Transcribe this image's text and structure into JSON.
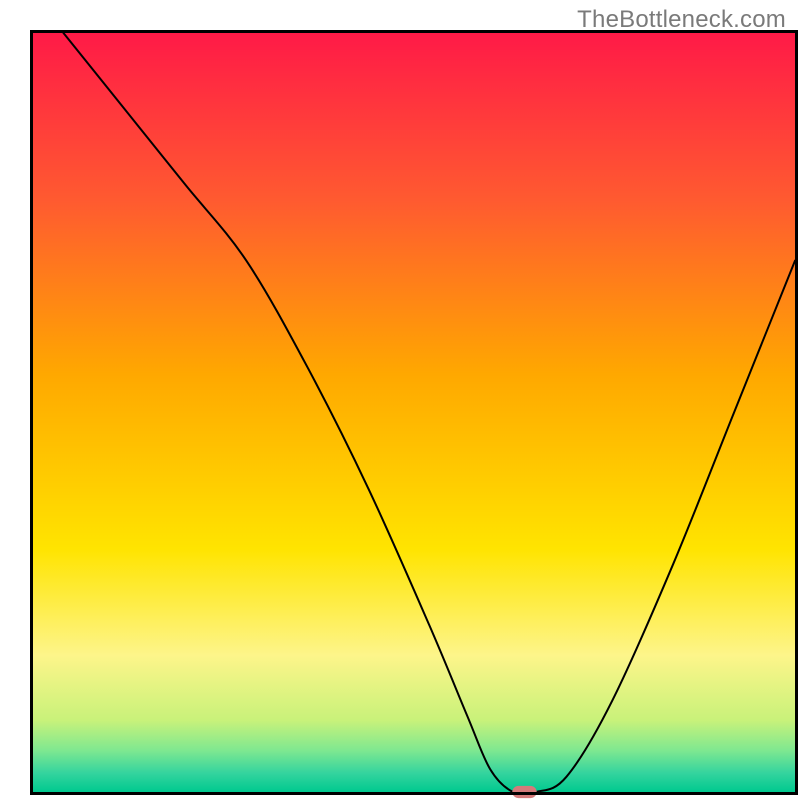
{
  "watermark": "TheBottleneck.com",
  "chart_data": {
    "type": "line",
    "title": "",
    "xlabel": "",
    "ylabel": "",
    "xlim": [
      0,
      100
    ],
    "ylim": [
      0,
      100
    ],
    "grid": false,
    "background_gradient_stops": [
      {
        "offset": 0.0,
        "color": "#ff1a47"
      },
      {
        "offset": 0.22,
        "color": "#ff5a30"
      },
      {
        "offset": 0.45,
        "color": "#ffa800"
      },
      {
        "offset": 0.68,
        "color": "#ffe400"
      },
      {
        "offset": 0.82,
        "color": "#fdf58a"
      },
      {
        "offset": 0.905,
        "color": "#c9f27a"
      },
      {
        "offset": 0.945,
        "color": "#7fe890"
      },
      {
        "offset": 0.975,
        "color": "#34d49e"
      },
      {
        "offset": 1.0,
        "color": "#00c98f"
      }
    ],
    "series": [
      {
        "name": "bottleneck-curve",
        "stroke": "#000000",
        "stroke_width": 2,
        "x": [
          4,
          12,
          20,
          28,
          36,
          44,
          52,
          57,
          60,
          63,
          66,
          70,
          76,
          84,
          92,
          100
        ],
        "y": [
          100,
          90,
          80,
          70,
          56,
          40,
          22,
          10,
          3,
          0,
          0,
          2,
          12,
          30,
          50,
          70
        ]
      }
    ],
    "marker": {
      "name": "optimal-marker",
      "x": 64.5,
      "y": 0,
      "w": 3.2,
      "h": 1.6,
      "color": "#d47a7a"
    },
    "axes": {
      "frame_color": "#000000",
      "frame_width": 3
    }
  }
}
